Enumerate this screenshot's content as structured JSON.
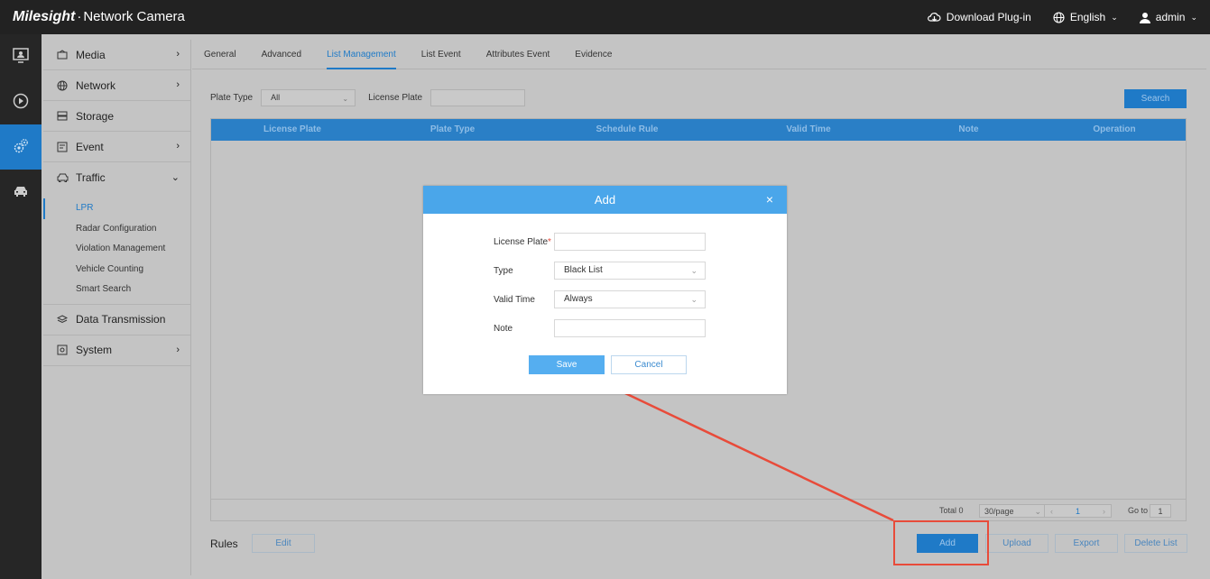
{
  "topbar": {
    "brand_logo": "Milesight",
    "brand_title": "Network Camera",
    "download": "Download Plug-in",
    "language": "English",
    "user": "admin"
  },
  "menu": {
    "media": "Media",
    "network": "Network",
    "storage": "Storage",
    "event": "Event",
    "traffic": "Traffic",
    "traffic_sub": [
      "LPR",
      "Radar Configuration",
      "Violation Management",
      "Vehicle Counting",
      "Smart Search"
    ],
    "data_transmission": "Data Transmission",
    "system": "System"
  },
  "tabs": [
    "General",
    "Advanced",
    "List Management",
    "List Event",
    "Attributes Event",
    "Evidence"
  ],
  "filter": {
    "plate_type_label": "Plate Type",
    "plate_type_value": "All",
    "license_plate_label": "License Plate",
    "search": "Search"
  },
  "table": {
    "headers": [
      "License Plate",
      "Plate Type",
      "Schedule Rule",
      "Valid Time",
      "Note",
      "Operation"
    ]
  },
  "pager": {
    "total": "Total 0",
    "per_page": "30/page",
    "page": "1",
    "goto_label": "Go to",
    "goto_value": "1"
  },
  "bottom": {
    "rules_label": "Rules",
    "edit": "Edit",
    "add": "Add",
    "upload": "Upload",
    "export": "Export",
    "delete_list": "Delete List"
  },
  "dialog": {
    "title": "Add",
    "close": "×",
    "license_plate_label": "License Plate",
    "type_label": "Type",
    "type_value": "Black List",
    "valid_time_label": "Valid Time",
    "valid_time_value": "Always",
    "note_label": "Note",
    "save": "Save",
    "cancel": "Cancel"
  },
  "colors": {
    "accent": "#1f7ac7",
    "dialog_header": "#4aa6ea",
    "annotation": "#e84b3a"
  }
}
